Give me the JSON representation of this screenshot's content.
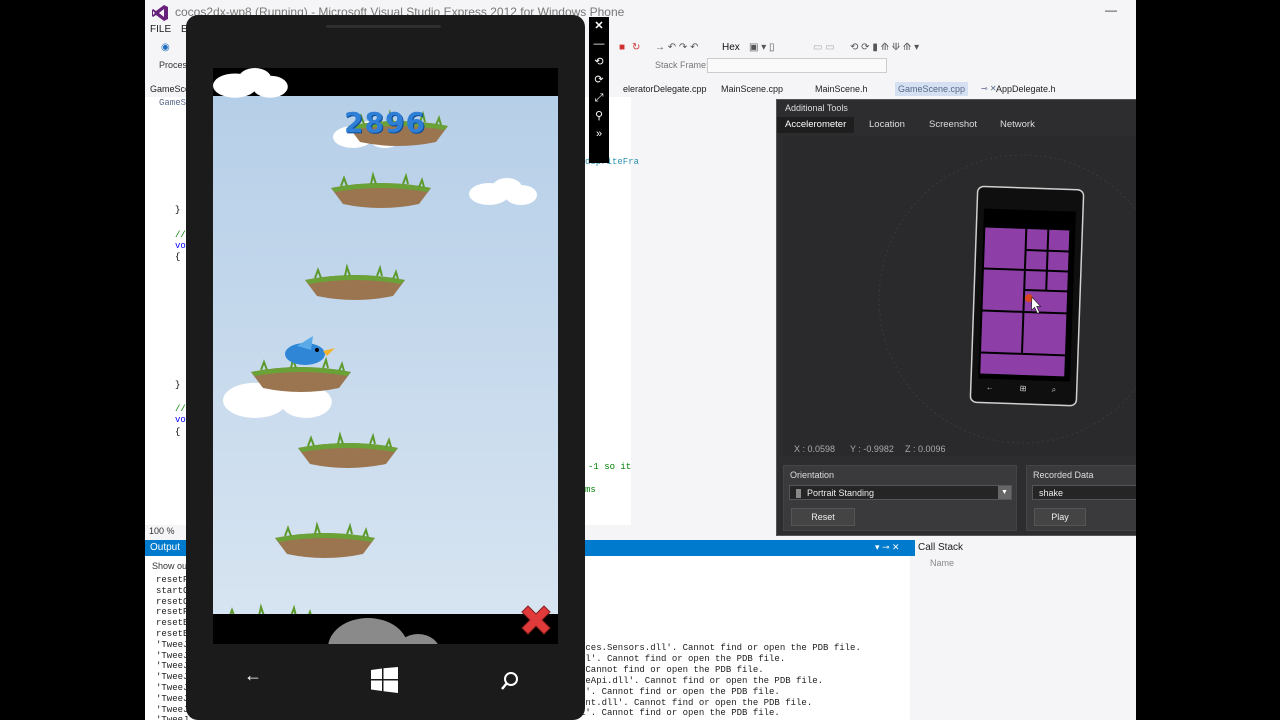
{
  "window": {
    "title": "cocos2dx-wp8 (Running) - Microsoft Visual Studio Express 2012 for Windows Phone",
    "menu": [
      "FILE",
      "EI"
    ],
    "process_label": "Process",
    "stack_frame_label": "Stack Frame:",
    "hex_label": "Hex"
  },
  "tabs": [
    {
      "label": "GameScen",
      "active": false
    },
    {
      "label": "eleratorDelegate.cpp",
      "active": false
    },
    {
      "label": "MainScene.cpp",
      "active": false
    },
    {
      "label": "MainScene.h",
      "active": false
    },
    {
      "label": "GameScene.cpp",
      "active": true
    },
    {
      "label": "AppDelegate.h",
      "active": false
    }
  ],
  "editor": {
    "subtab": "GameS",
    "code_right": [
      "dSpriteFra",
      "-1 so it",
      "ms"
    ],
    "code_left": [
      "}",
      "//",
      "vo",
      "{",
      "}",
      "//",
      "vo",
      "{"
    ],
    "zoom": "100 %"
  },
  "output": {
    "title": "Output",
    "show_label": "Show out",
    "left_lines": [
      "resetP",
      "startG",
      "resetC",
      "resetP",
      "resetB",
      "resetB",
      "'TweeJ",
      "'TweeJ",
      "'TweeJ",
      "'TweeJ",
      "'TweeJ",
      "'TweeJ",
      "'TweeJ",
      "'TweeJ"
    ],
    "right_lines": [
      "ices.Sensors.dll'. Cannot find or open the PDB file.",
      "ll'. Cannot find or open the PDB file.",
      " Cannot find or open the PDB file.",
      "ceApi.dll'. Cannot find or open the PDB file.",
      "L'. Cannot find or open the PDB file.",
      "ent.dll'. Cannot find or open the PDB file.",
      "l'. Cannot find or open the PDB file."
    ]
  },
  "callstack": {
    "title": "Call Stack",
    "column": "Name"
  },
  "tools": {
    "title": "Additional Tools",
    "tabs": [
      "Accelerometer",
      "Location",
      "Screenshot",
      "Network"
    ],
    "active_tab": "Accelerometer",
    "x": "X : 0.0598",
    "y": "Y : -0.9982",
    "z": "Z : 0.0096",
    "orientation_label": "Orientation",
    "orientation_value": "Portrait Standing",
    "reset_button": "Reset",
    "recorded_label": "Recorded Data",
    "recorded_value": "shake",
    "play_button": "Play"
  },
  "game": {
    "score": "2896"
  },
  "colors": {
    "accent": "#007acc",
    "tile": "#8e3fa7",
    "score": "#2f7fd6",
    "dark": "#2d2d30"
  }
}
